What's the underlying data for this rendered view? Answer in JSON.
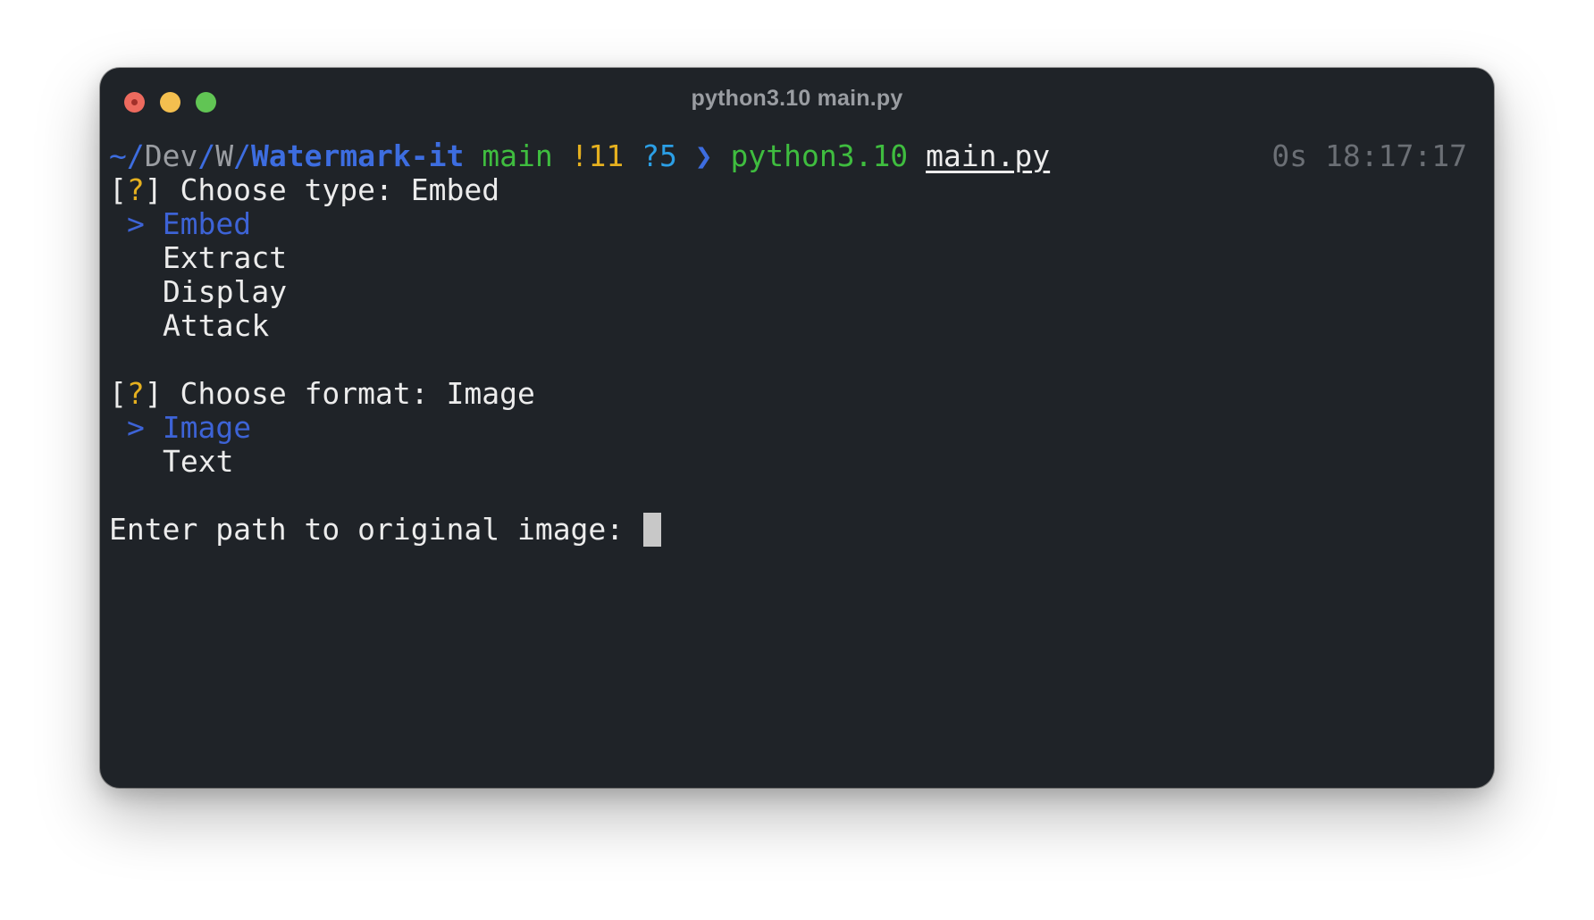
{
  "window": {
    "title": "python3.10 main.py",
    "buttons": {
      "close_color": "#ed6a5e",
      "minimize_color": "#f4bf4f",
      "maximize_color": "#61c554"
    }
  },
  "colors": {
    "path_dim": "#9a9da2",
    "path_accent": "#3d6de0",
    "branch": "#3fbd3f",
    "modified": "#e5b01f",
    "untracked": "#2b9fe6",
    "prompt_arrow": "#3d6de0",
    "selection": "#3d63d6",
    "question_mark": "#e5b01f",
    "default_text": "#ececec",
    "meta": "#6b6f75",
    "cursor": "#c8c8c8"
  },
  "prompt": {
    "tilde_sep": "~/",
    "dev": "Dev",
    "sep1": "/",
    "w": "W",
    "sep2": "/",
    "repo": "Watermark-it",
    "branch": "main",
    "modified": "!11",
    "untracked": "?5",
    "arrow": "❯",
    "interpreter": "python3.10",
    "script": "main.py",
    "duration": "0s",
    "time": "18:17:17"
  },
  "q1": {
    "bracket_open": "[",
    "mark": "?",
    "bracket_close": "]",
    "question": " Choose type: ",
    "answer": "Embed",
    "pointer": "> ",
    "options": [
      "Embed",
      "Extract",
      "Display",
      "Attack"
    ]
  },
  "q2": {
    "bracket_open": "[",
    "mark": "?",
    "bracket_close": "]",
    "question": " Choose format: ",
    "answer": "Image",
    "pointer": "> ",
    "options": [
      "Image",
      "Text"
    ]
  },
  "input": {
    "label": "Enter path to original image: ",
    "value": ""
  }
}
